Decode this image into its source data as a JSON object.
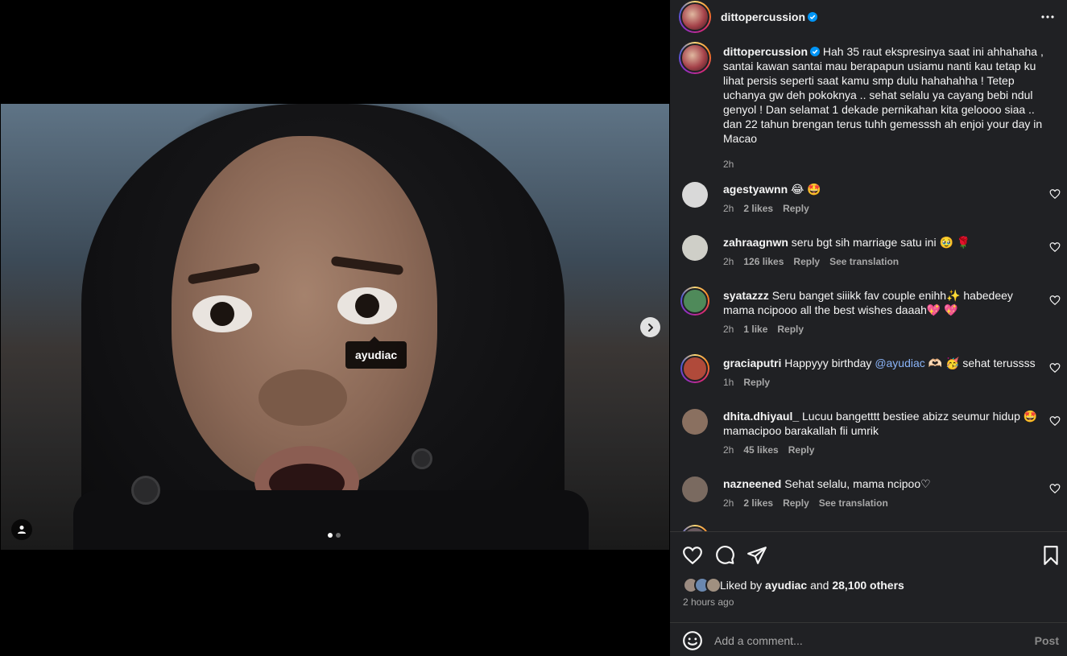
{
  "post": {
    "author": "dittopercussion",
    "verified": true,
    "caption": "Hah 35 raut ekspresinya saat ini ahhahaha , santai kawan santai mau berapapun usiamu nanti kau tetap ku lihat persis seperti saat kamu smp dulu hahahahha ! Tetep uchanya gw deh pokoknya .. sehat selalu ya cayang bebi ndul genyol ! Dan selamat 1 dekade pernikahan kita geloooo siaa .. dan 22 tahun brengan terus tuhh gemesssh ah enjoi your day in Macao",
    "caption_time": "2h",
    "media": {
      "tag_label": "ayudiac",
      "slide_index": 1,
      "slide_count": 2
    }
  },
  "comments": [
    {
      "username": "agestyawnn",
      "text": "😂 🤩",
      "time": "2h",
      "likes": "2 likes",
      "reply": "Reply",
      "see_translation": "",
      "avatar_color": "#d9d9d9"
    },
    {
      "username": "zahraagnwn",
      "text": "seru bgt sih marriage satu ini 🥹 🌹",
      "time": "2h",
      "likes": "126 likes",
      "reply": "Reply",
      "see_translation": "See translation",
      "avatar_color": "#cfcfc8"
    },
    {
      "username": "syatazzz",
      "text": "Seru banget siiikk fav couple enihh✨ habedeey mama ncipooo all the best wishes daaah💖 💖",
      "time": "2h",
      "likes": "1 like",
      "reply": "Reply",
      "see_translation": "",
      "avatar_color": "#4f8a5a"
    },
    {
      "username": "graciaputri",
      "text_before": "Happyyy birthday ",
      "mention": "@ayudiac",
      "text_after": " 🫶🏻 🥳 sehat terussss",
      "time": "1h",
      "likes": "",
      "reply": "Reply",
      "see_translation": "",
      "avatar_color": "#b04a3a"
    },
    {
      "username": "dhita.dhiyaul_",
      "text": "Lucuu bangetttt bestiee abizz seumur hidup 🤩 mamacipoo barakallah fii umrik",
      "time": "2h",
      "likes": "45 likes",
      "reply": "Reply",
      "see_translation": "",
      "avatar_color": "#8a7060"
    },
    {
      "username": "nazneened",
      "text": "Sehat selalu, mama ncipoo♡",
      "time": "2h",
      "likes": "2 likes",
      "reply": "Reply",
      "see_translation": "See translation",
      "avatar_color": "#7a6a60"
    }
  ],
  "engagement": {
    "liked_by_prefix": "Liked by ",
    "liked_by_user": "ayudiac",
    "liked_by_and": " and ",
    "liked_by_others": "28,100 others",
    "post_time": "2 hours ago"
  },
  "comment_box": {
    "placeholder": "Add a comment...",
    "post_label": "Post"
  },
  "icons": {
    "more": "more-horizontal-icon",
    "next": "chevron-right-icon",
    "user_tag": "user-tag-icon",
    "like": "heart-icon",
    "comment": "comment-icon",
    "share": "send-icon",
    "save": "bookmark-icon",
    "emoji": "emoji-icon",
    "verified": "verified-badge-icon"
  },
  "colors": {
    "panel_bg": "#202124",
    "text_secondary": "#a8a8a8",
    "verified_blue": "#0095f6",
    "mention": "#8ab4f8"
  }
}
